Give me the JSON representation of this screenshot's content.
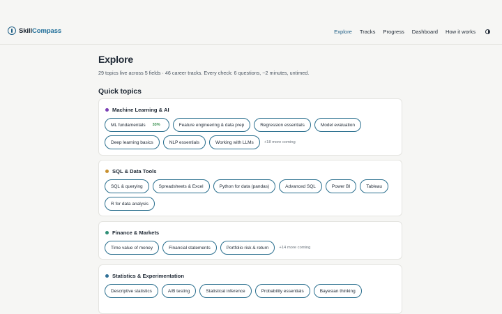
{
  "brand": {
    "name_part1": "Skill",
    "name_part2": "Compass"
  },
  "nav": {
    "items": [
      "Explore",
      "Tracks",
      "Progress",
      "Dashboard",
      "How it works"
    ],
    "active": "Explore"
  },
  "icons": {
    "brand": "compass-logo-icon",
    "theme": "theme-toggle-icon"
  },
  "colors": {
    "accent": "#1f5f86",
    "chip_border": "#2a6f8e",
    "progress_text": "#2e8a45",
    "cat_ml": "#7b3fb5",
    "cat_sql": "#c8902e",
    "cat_finance": "#2f8f76",
    "cat_stats": "#2f6f96"
  },
  "page": {
    "title": "Explore",
    "subtitle": "29 topics live across 5 fields · 46 career tracks. Every check: 6 questions, ~2 minutes, untimed.",
    "section_title": "Quick topics"
  },
  "categories": [
    {
      "title": "Machine Learning & AI",
      "topics": [
        {
          "label": "ML fundamentals",
          "progress": "33%"
        },
        {
          "label": "Feature engineering & data prep"
        },
        {
          "label": "Regression essentials"
        },
        {
          "label": "Model evaluation"
        },
        {
          "label": "Deep learning basics"
        },
        {
          "label": "NLP essentials"
        },
        {
          "label": "Working with LLMs"
        }
      ],
      "more": "+18 more coming"
    },
    {
      "title": "SQL & Data Tools",
      "topics": [
        {
          "label": "SQL & querying"
        },
        {
          "label": "Spreadsheets & Excel"
        },
        {
          "label": "Python for data (pandas)"
        },
        {
          "label": "Advanced SQL"
        },
        {
          "label": "Power BI"
        },
        {
          "label": "Tableau"
        },
        {
          "label": "R for data analysis"
        }
      ]
    },
    {
      "title": "Finance & Markets",
      "topics": [
        {
          "label": "Time value of money"
        },
        {
          "label": "Financial statements"
        },
        {
          "label": "Portfolio risk & return"
        }
      ],
      "more": "+14 more coming"
    },
    {
      "title": "Statistics & Experimentation",
      "topics": [
        {
          "label": "Descriptive statistics"
        },
        {
          "label": "A/B testing"
        },
        {
          "label": "Statistical inference"
        },
        {
          "label": "Probability essentials"
        },
        {
          "label": "Bayesian thinking"
        }
      ]
    }
  ]
}
